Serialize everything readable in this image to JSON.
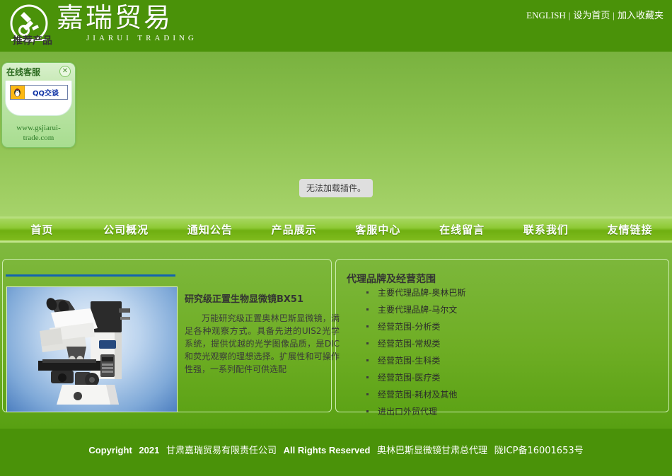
{
  "header": {
    "logo_icon": "microscope-icon",
    "brand_cn": "嘉瑞贸易",
    "brand_en": "JIARUI TRADING",
    "toplinks": {
      "english": "ENGLISH",
      "sep1": "|",
      "set_home": "设为首页",
      "sep2": "|",
      "add_favorite": "加入收藏夹"
    }
  },
  "banner": {
    "plugin_message": "无法加载插件。"
  },
  "qq_widget": {
    "title": "在线客服",
    "close_icon": "close-icon",
    "qq_icon": "qq-penguin-icon",
    "qq_button_label": "QQ交谈",
    "url_line1": "www.gsjiarui-",
    "url_line2": "trade.com"
  },
  "nav": {
    "items": [
      {
        "label": "首页"
      },
      {
        "label": "公司概况"
      },
      {
        "label": "通知公告"
      },
      {
        "label": "产品展示"
      },
      {
        "label": "客服中心"
      },
      {
        "label": "在线留言"
      },
      {
        "label": "联系我们"
      },
      {
        "label": "友情链接"
      }
    ]
  },
  "left_panel": {
    "title": "推荐产品",
    "product": {
      "image_alt": "microscope-photo",
      "name": "研究级正置生物显微镜BX51",
      "description": "万能研究级正置奥林巴斯显微镜，满足各种观察方式。具备先进的UIS2光学系统，提供优越的光学图像品质，是DIC和荧光观察的理想选择。扩展性和可操作性强，一系列配件可供选配"
    }
  },
  "right_panel": {
    "title": "代理品牌及经营范围",
    "items": [
      {
        "label": "主要代理品牌-奥林巴斯"
      },
      {
        "label": "主要代理品牌-马尔文"
      },
      {
        "label": "经营范围-分析类"
      },
      {
        "label": "经营范围-常规类"
      },
      {
        "label": "经营范围-生科类"
      },
      {
        "label": "经营范围-医疗类"
      },
      {
        "label": "经营范围-耗材及其他"
      },
      {
        "label": "进出口外贸代理"
      }
    ]
  },
  "footer": {
    "copyright": "Copyright",
    "year": "2021",
    "company": "甘肃嘉瑞贸易有限责任公司",
    "rights": "All Rights Reserved",
    "agency": "奥林巴斯显微镜甘肃总代理",
    "icp": "陇ICP备16001653号"
  },
  "colors": {
    "header_green": "#4a9209",
    "banner_top": "#79b23f",
    "banner_bottom": "#a6d36a",
    "nav_green": "#6faf11",
    "underline_blue": "#1263b0"
  }
}
